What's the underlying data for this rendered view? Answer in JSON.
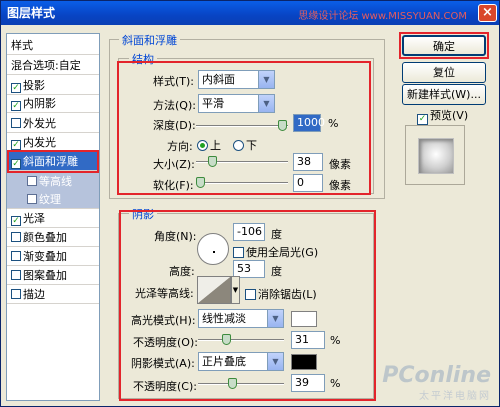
{
  "window": {
    "title": "图层样式",
    "watermark": "思缘设计论坛 www.MISSYUAN.COM",
    "close_glyph": "×"
  },
  "style_list": {
    "items": [
      {
        "label": "样式",
        "checkbox": false,
        "checked": false
      },
      {
        "label": "混合选项:自定",
        "checkbox": false,
        "checked": false
      },
      {
        "label": "投影",
        "checkbox": true,
        "checked": true
      },
      {
        "label": "内阴影",
        "checkbox": true,
        "checked": true
      },
      {
        "label": "外发光",
        "checkbox": true,
        "checked": false
      },
      {
        "label": "内发光",
        "checkbox": true,
        "checked": true
      },
      {
        "label": "斜面和浮雕",
        "checkbox": true,
        "checked": true
      },
      {
        "label": "等高线",
        "checkbox": true,
        "checked": false
      },
      {
        "label": "纹理",
        "checkbox": true,
        "checked": false
      },
      {
        "label": "光泽",
        "checkbox": true,
        "checked": true
      },
      {
        "label": "颜色叠加",
        "checkbox": true,
        "checked": false
      },
      {
        "label": "渐变叠加",
        "checkbox": true,
        "checked": false
      },
      {
        "label": "图案叠加",
        "checkbox": true,
        "checked": false
      },
      {
        "label": "描边",
        "checkbox": true,
        "checked": false
      }
    ]
  },
  "bevel": {
    "group_title": "斜面和浮雕",
    "structure_title": "结构",
    "style_label": "样式(T):",
    "style_value": "内斜面",
    "technique_label": "方法(Q):",
    "technique_value": "平滑",
    "depth_label": "深度(D):",
    "depth_value": "1000",
    "depth_unit": "%",
    "depth_level": 1.0,
    "direction_label": "方向:",
    "direction_up": "上",
    "direction_down": "下",
    "size_label": "大小(Z):",
    "size_value": "38",
    "size_unit": "像素",
    "size_level": 0.15,
    "soften_label": "软化(F):",
    "soften_value": "0",
    "soften_unit": "像素",
    "soften_level": 0.0
  },
  "shading": {
    "title": "阴影",
    "angle_label": "角度(N):",
    "angle_value": "-106",
    "angle_unit": "度",
    "global_light_label": "使用全局光(G)",
    "altitude_label": "高度:",
    "altitude_value": "53",
    "altitude_unit": "度",
    "gloss_label": "光泽等高线:",
    "antialias_label": "消除锯齿(L)",
    "highlight_mode_label": "高光模式(H):",
    "highlight_mode_value": "线性减淡",
    "highlight_opacity_label": "不透明度(O):",
    "highlight_opacity_value": "31",
    "highlight_opacity_level": 0.31,
    "percent": "%",
    "shadow_mode_label": "阴影模式(A):",
    "shadow_mode_value": "正片叠底",
    "shadow_opacity_label": "不透明度(C):",
    "shadow_opacity_value": "39",
    "shadow_opacity_level": 0.39,
    "highlight_color": "#ffffff",
    "shadow_color": "#000000"
  },
  "buttons": {
    "ok": "确定",
    "reset": "复位",
    "new_style": "新建样式(W)...",
    "preview": "预览(V)"
  },
  "watermark2": {
    "brand": "PConline",
    "sub": "太平洋电脑网"
  },
  "colors": {
    "annotation_red": "#e3242b",
    "accent_blue": "#0046d5",
    "selection": "#316ac5"
  }
}
